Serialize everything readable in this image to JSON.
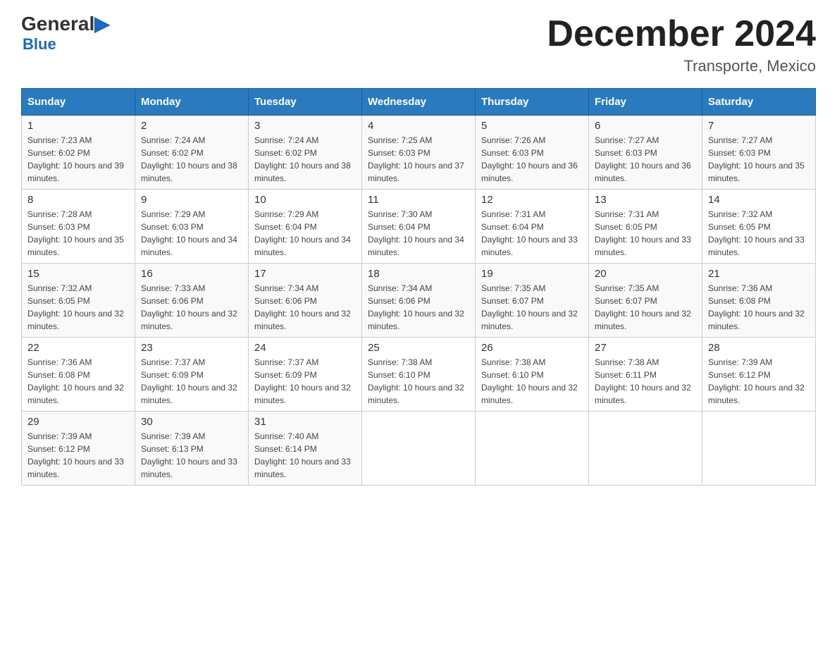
{
  "logo": {
    "general": "General",
    "arrow": "▲",
    "blue": "Blue"
  },
  "title": "December 2024",
  "subtitle": "Transporte, Mexico",
  "days_header": [
    "Sunday",
    "Monday",
    "Tuesday",
    "Wednesday",
    "Thursday",
    "Friday",
    "Saturday"
  ],
  "weeks": [
    [
      {
        "day": "1",
        "sunrise": "7:23 AM",
        "sunset": "6:02 PM",
        "daylight": "10 hours and 39 minutes."
      },
      {
        "day": "2",
        "sunrise": "7:24 AM",
        "sunset": "6:02 PM",
        "daylight": "10 hours and 38 minutes."
      },
      {
        "day": "3",
        "sunrise": "7:24 AM",
        "sunset": "6:02 PM",
        "daylight": "10 hours and 38 minutes."
      },
      {
        "day": "4",
        "sunrise": "7:25 AM",
        "sunset": "6:03 PM",
        "daylight": "10 hours and 37 minutes."
      },
      {
        "day": "5",
        "sunrise": "7:26 AM",
        "sunset": "6:03 PM",
        "daylight": "10 hours and 36 minutes."
      },
      {
        "day": "6",
        "sunrise": "7:27 AM",
        "sunset": "6:03 PM",
        "daylight": "10 hours and 36 minutes."
      },
      {
        "day": "7",
        "sunrise": "7:27 AM",
        "sunset": "6:03 PM",
        "daylight": "10 hours and 35 minutes."
      }
    ],
    [
      {
        "day": "8",
        "sunrise": "7:28 AM",
        "sunset": "6:03 PM",
        "daylight": "10 hours and 35 minutes."
      },
      {
        "day": "9",
        "sunrise": "7:29 AM",
        "sunset": "6:03 PM",
        "daylight": "10 hours and 34 minutes."
      },
      {
        "day": "10",
        "sunrise": "7:29 AM",
        "sunset": "6:04 PM",
        "daylight": "10 hours and 34 minutes."
      },
      {
        "day": "11",
        "sunrise": "7:30 AM",
        "sunset": "6:04 PM",
        "daylight": "10 hours and 34 minutes."
      },
      {
        "day": "12",
        "sunrise": "7:31 AM",
        "sunset": "6:04 PM",
        "daylight": "10 hours and 33 minutes."
      },
      {
        "day": "13",
        "sunrise": "7:31 AM",
        "sunset": "6:05 PM",
        "daylight": "10 hours and 33 minutes."
      },
      {
        "day": "14",
        "sunrise": "7:32 AM",
        "sunset": "6:05 PM",
        "daylight": "10 hours and 33 minutes."
      }
    ],
    [
      {
        "day": "15",
        "sunrise": "7:32 AM",
        "sunset": "6:05 PM",
        "daylight": "10 hours and 32 minutes."
      },
      {
        "day": "16",
        "sunrise": "7:33 AM",
        "sunset": "6:06 PM",
        "daylight": "10 hours and 32 minutes."
      },
      {
        "day": "17",
        "sunrise": "7:34 AM",
        "sunset": "6:06 PM",
        "daylight": "10 hours and 32 minutes."
      },
      {
        "day": "18",
        "sunrise": "7:34 AM",
        "sunset": "6:06 PM",
        "daylight": "10 hours and 32 minutes."
      },
      {
        "day": "19",
        "sunrise": "7:35 AM",
        "sunset": "6:07 PM",
        "daylight": "10 hours and 32 minutes."
      },
      {
        "day": "20",
        "sunrise": "7:35 AM",
        "sunset": "6:07 PM",
        "daylight": "10 hours and 32 minutes."
      },
      {
        "day": "21",
        "sunrise": "7:36 AM",
        "sunset": "6:08 PM",
        "daylight": "10 hours and 32 minutes."
      }
    ],
    [
      {
        "day": "22",
        "sunrise": "7:36 AM",
        "sunset": "6:08 PM",
        "daylight": "10 hours and 32 minutes."
      },
      {
        "day": "23",
        "sunrise": "7:37 AM",
        "sunset": "6:09 PM",
        "daylight": "10 hours and 32 minutes."
      },
      {
        "day": "24",
        "sunrise": "7:37 AM",
        "sunset": "6:09 PM",
        "daylight": "10 hours and 32 minutes."
      },
      {
        "day": "25",
        "sunrise": "7:38 AM",
        "sunset": "6:10 PM",
        "daylight": "10 hours and 32 minutes."
      },
      {
        "day": "26",
        "sunrise": "7:38 AM",
        "sunset": "6:10 PM",
        "daylight": "10 hours and 32 minutes."
      },
      {
        "day": "27",
        "sunrise": "7:38 AM",
        "sunset": "6:11 PM",
        "daylight": "10 hours and 32 minutes."
      },
      {
        "day": "28",
        "sunrise": "7:39 AM",
        "sunset": "6:12 PM",
        "daylight": "10 hours and 32 minutes."
      }
    ],
    [
      {
        "day": "29",
        "sunrise": "7:39 AM",
        "sunset": "6:12 PM",
        "daylight": "10 hours and 33 minutes."
      },
      {
        "day": "30",
        "sunrise": "7:39 AM",
        "sunset": "6:13 PM",
        "daylight": "10 hours and 33 minutes."
      },
      {
        "day": "31",
        "sunrise": "7:40 AM",
        "sunset": "6:14 PM",
        "daylight": "10 hours and 33 minutes."
      },
      null,
      null,
      null,
      null
    ]
  ]
}
